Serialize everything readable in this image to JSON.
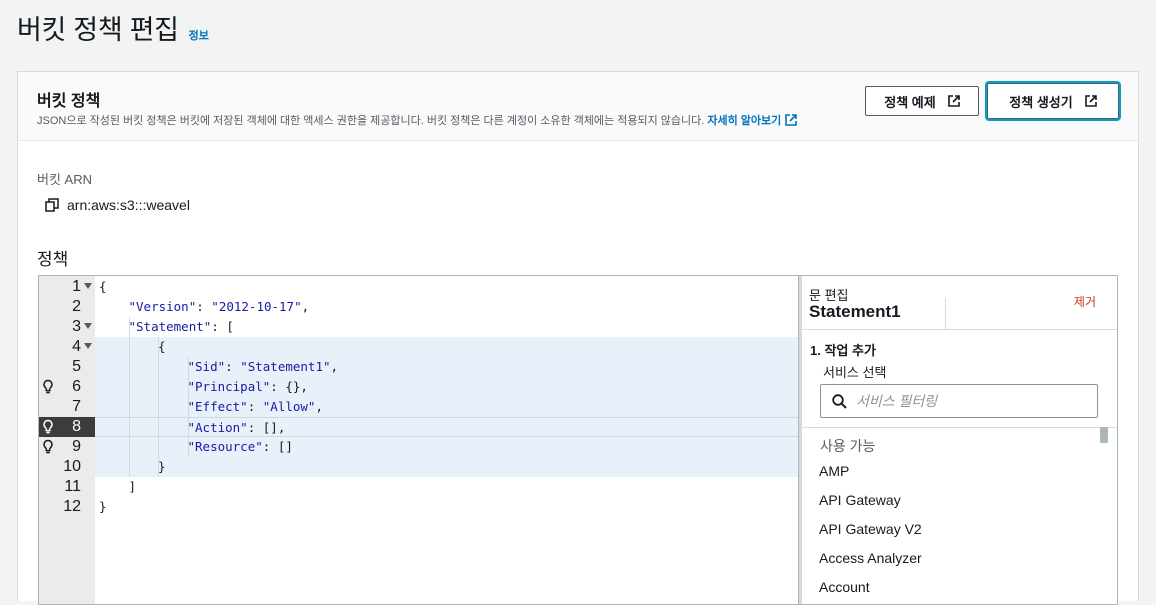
{
  "page": {
    "title": "버킷 정책 편집",
    "info_link": "정보"
  },
  "panel": {
    "title": "버킷 정책",
    "description": "JSON으로 작성된 버킷 정책은 버킷에 저장된 객체에 대한 액세스 권한을 제공합니다. 버킷 정책은 다른 계정이 소유한 객체에는 적용되지 않습니다.",
    "learn_more": "자세히 알아보기",
    "btn_examples": "정책 예제",
    "btn_generator": "정책 생성기"
  },
  "arn": {
    "label": "버킷 ARN",
    "value": "arn:aws:s3:::weavel"
  },
  "policy": {
    "label": "정책"
  },
  "editor": {
    "lines": [
      {
        "num": "1",
        "text": "{"
      },
      {
        "num": "2",
        "key": "\"Version\"",
        "sep": ": ",
        "val": "\"2012-10-17\"",
        "tail": ","
      },
      {
        "num": "3",
        "key": "\"Statement\"",
        "sep": ": ",
        "tail": "["
      },
      {
        "num": "4",
        "text": "{"
      },
      {
        "num": "5",
        "key": "\"Sid\"",
        "sep": ": ",
        "val": "\"Statement1\"",
        "tail": ","
      },
      {
        "num": "6",
        "key": "\"Principal\"",
        "sep": ": ",
        "tail": "{},"
      },
      {
        "num": "7",
        "key": "\"Effect\"",
        "sep": ": ",
        "val": "\"Allow\"",
        "tail": ","
      },
      {
        "num": "8",
        "key": "\"Action\"",
        "sep": ": ",
        "tail": "[],"
      },
      {
        "num": "9",
        "key": "\"Resource\"",
        "sep": ": ",
        "tail": "[]"
      },
      {
        "num": "10",
        "text": "}"
      },
      {
        "num": "11",
        "text": "]"
      },
      {
        "num": "12",
        "text": "}"
      }
    ]
  },
  "statement_editor": {
    "label": "문 편집",
    "tab": "Statement1",
    "remove": "제거",
    "step": "1. 작업 추가",
    "service_label": "서비스 선택",
    "search_placeholder": "서비스 필터링",
    "group": "사용 가능",
    "services": [
      "AMP",
      "API Gateway",
      "API Gateway V2",
      "Access Analyzer",
      "Account"
    ]
  },
  "colors": {
    "link": "#0073bb",
    "remove": "#d13212",
    "focus": "#00a1c9"
  }
}
